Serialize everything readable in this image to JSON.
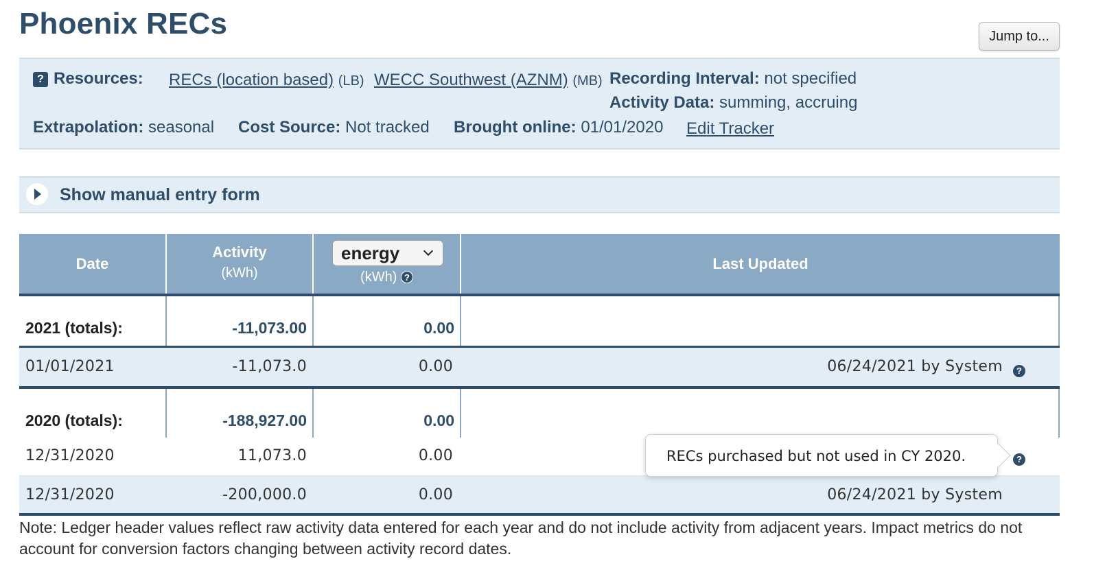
{
  "page": {
    "title": "Phoenix RECs",
    "jump_label": "Jump to..."
  },
  "info": {
    "resources_label": "Resources:",
    "resource_1": {
      "text": "RECs (location based)",
      "tag": "(LB)"
    },
    "resource_2": {
      "text": "WECC Southwest (AZNM)",
      "tag": "(MB)"
    },
    "recording_interval_label": "Recording Interval:",
    "recording_interval_value": "not specified",
    "activity_data_label": "Activity Data:",
    "activity_data_value": "summing, accruing",
    "extrapolation_label": "Extrapolation:",
    "extrapolation_value": "seasonal",
    "cost_source_label": "Cost Source:",
    "cost_source_value": "Not tracked",
    "brought_online_label": "Brought online:",
    "brought_online_value": "01/01/2020",
    "edit_tracker": "Edit Tracker"
  },
  "manual_entry": {
    "label": "Show manual entry form"
  },
  "ledger": {
    "headers": {
      "date": "Date",
      "activity": "Activity",
      "activity_unit": "(kWh)",
      "metric_selected": "energy",
      "metric_unit": "(kWh)",
      "last_updated": "Last Updated"
    },
    "groups": [
      {
        "totals_label": "2021 (totals):",
        "totals_activity": "-11,073.00",
        "totals_metric": "0.00",
        "rows": [
          {
            "date": "01/01/2021",
            "activity": "-11,073.0",
            "metric": "0.00",
            "updated": "06/24/2021 by System"
          }
        ]
      },
      {
        "totals_label": "2020 (totals):",
        "totals_activity": "-188,927.00",
        "totals_metric": "0.00",
        "rows": [
          {
            "date": "12/31/2020",
            "activity": "11,073.0",
            "metric": "0.00",
            "updated": ""
          },
          {
            "date": "12/31/2020",
            "activity": "-200,000.0",
            "metric": "0.00",
            "updated": "06/24/2021 by System"
          }
        ]
      }
    ]
  },
  "tooltip": {
    "text": "RECs purchased but not used in CY 2020."
  },
  "note": "Note: Ledger header values reflect raw activity data entered for each year and do not include activity from adjacent years. Impact metrics do not account for conversion factors changing between activity record dates."
}
